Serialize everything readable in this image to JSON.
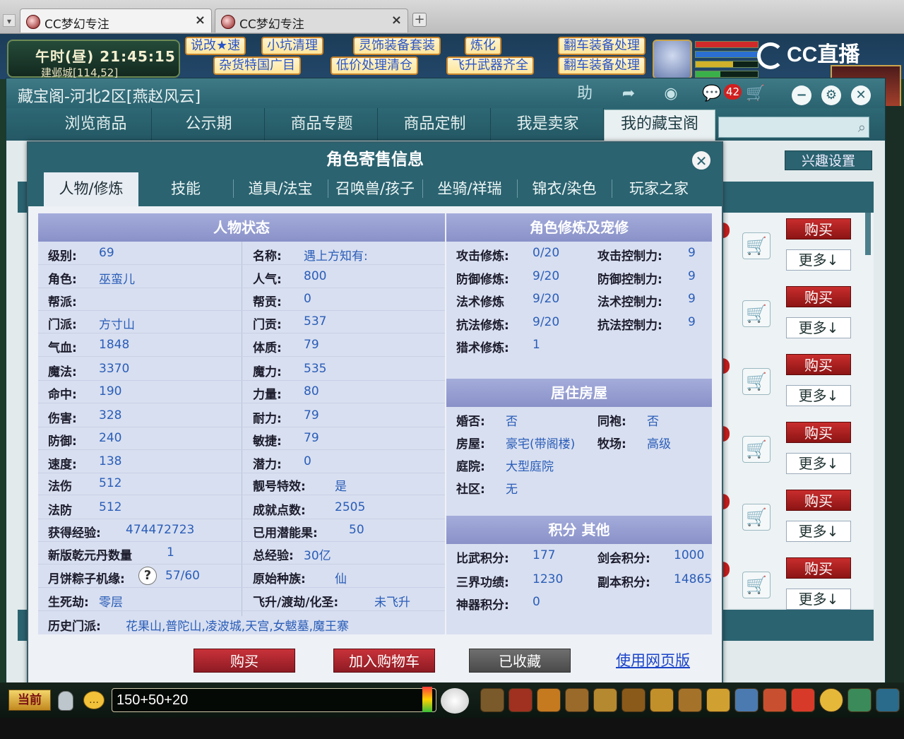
{
  "browser": {
    "tabs": [
      {
        "title": "CC梦幻专注",
        "close": "×"
      },
      {
        "title": "CC梦幻专注",
        "close": "×"
      }
    ],
    "new_tab": "+",
    "menu": "▾"
  },
  "game_hud": {
    "clock": "午时(昼)  21:45:15",
    "location": "建邺城[114,52]",
    "ads_row1": [
      "说改★速",
      "小坑清理",
      "灵饰装备套装",
      "炼化",
      "翻车装备处理"
    ],
    "ads_row2": [
      "杂货特国广目",
      "低价处理清仓",
      "飞升武器齐全",
      "翻车装备处理"
    ],
    "cc_logo": "CC直播"
  },
  "main_window": {
    "title": "藏宝阁-河北2区[燕赵风云]",
    "toolbar": {
      "help": "助",
      "share": "➦",
      "record": "◉",
      "chat": "💬",
      "chat_badge": "42",
      "cart": "🛒",
      "minimize": "−",
      "settings": "⚙",
      "close": "✕"
    },
    "nav": [
      "浏览商品",
      "公示期",
      "商品专题",
      "商品定制",
      "我是卖家",
      "我的藏宝阁"
    ],
    "nav_active_index": 5,
    "search_placeholder": "",
    "interest_button": "兴趣设置",
    "list_buttons": {
      "buy": "购买",
      "more": "更多↓"
    },
    "list_count": 6
  },
  "modal": {
    "title": "角色寄售信息",
    "close": "✕",
    "tabs": [
      "人物/修炼",
      "技能",
      "道具/法宝",
      "召唤兽/孩子",
      "坐骑/祥瑞",
      "锦衣/染色",
      "玩家之家"
    ],
    "active_tab": 0,
    "status_panel": {
      "header": "人物状态",
      "left": [
        {
          "key": "级别:",
          "val": "69"
        },
        {
          "key": "角色:",
          "val": "巫蛮儿"
        },
        {
          "key": "帮派:",
          "val": ""
        },
        {
          "key": "门派:",
          "val": "方寸山"
        },
        {
          "key": "气血:",
          "val": "1848"
        },
        {
          "key": "魔法:",
          "val": "3370"
        },
        {
          "key": "命中:",
          "val": "190"
        },
        {
          "key": "伤害:",
          "val": "328"
        },
        {
          "key": "防御:",
          "val": "240"
        },
        {
          "key": "速度:",
          "val": "138"
        },
        {
          "key": "法伤",
          "val": "512"
        },
        {
          "key": "法防",
          "val": "512"
        },
        {
          "key": "获得经验:",
          "val": "474472723"
        },
        {
          "key": "新版乾元丹数量",
          "val": "1"
        },
        {
          "key": "月饼粽子机缘:",
          "val": "57/60"
        },
        {
          "key": "生死劫:",
          "val": "零层"
        }
      ],
      "right": [
        {
          "key": "名称:",
          "val": "遇上方知有:"
        },
        {
          "key": "人气:",
          "val": "800"
        },
        {
          "key": "帮贡:",
          "val": "0"
        },
        {
          "key": "门贡:",
          "val": "537"
        },
        {
          "key": "体质:",
          "val": "79"
        },
        {
          "key": "魔力:",
          "val": "535"
        },
        {
          "key": "力量:",
          "val": "80"
        },
        {
          "key": "耐力:",
          "val": "79"
        },
        {
          "key": "敏捷:",
          "val": "79"
        },
        {
          "key": "潜力:",
          "val": "0"
        },
        {
          "key": "靓号特效:",
          "val": "是"
        },
        {
          "key": "成就点数:",
          "val": "2505"
        },
        {
          "key": "已用潜能果:",
          "val": "50"
        },
        {
          "key": "总经验:",
          "val": "30亿"
        },
        {
          "key": "原始种族:",
          "val": "仙"
        },
        {
          "key": "飞升/渡劫/化圣:",
          "val": "未飞升"
        }
      ],
      "history_key": "历史门派:",
      "history_val": "花果山,普陀山,凌波城,天宫,女魃墓,魔王寨",
      "help_glyph": "?"
    },
    "cultivation_panel": {
      "header": "角色修炼及宠修",
      "rows": [
        {
          "k1": "攻击修炼:",
          "v1": "0/20",
          "k2": "攻击控制力:",
          "v2": "9"
        },
        {
          "k1": "防御修炼:",
          "v1": "9/20",
          "k2": "防御控制力:",
          "v2": "9"
        },
        {
          "k1": "法术修炼",
          "v1": "9/20",
          "k2": "法术控制力:",
          "v2": "9"
        },
        {
          "k1": "抗法修炼:",
          "v1": "9/20",
          "k2": "抗法控制力:",
          "v2": "9"
        },
        {
          "k1": "猎术修炼:",
          "v1": "1",
          "k2": "",
          "v2": ""
        }
      ]
    },
    "house_panel": {
      "header": "居住房屋",
      "rows": [
        {
          "k1": "婚否:",
          "v1": "否",
          "k2": "同袍:",
          "v2": "否"
        },
        {
          "k1": "房屋:",
          "v1": "豪宅(带阁楼)",
          "k2": "牧场:",
          "v2": "高级"
        },
        {
          "k1": "庭院:",
          "v1": "大型庭院",
          "k2": "",
          "v2": ""
        },
        {
          "k1": "社区:",
          "v1": "无",
          "k2": "",
          "v2": ""
        }
      ]
    },
    "score_panel": {
      "header": "积分 其他",
      "rows": [
        {
          "k1": "比武积分:",
          "v1": "177",
          "k2": "剑会积分:",
          "v2": "1000"
        },
        {
          "k1": "三界功绩:",
          "v1": "1230",
          "k2": "副本积分:",
          "v2": "14865"
        },
        {
          "k1": "神器积分:",
          "v1": "0",
          "k2": "",
          "v2": ""
        }
      ]
    },
    "actions": {
      "buy": "购买",
      "add_cart": "加入购物车",
      "favorited": "已收藏",
      "web_version": "使用网页版"
    }
  },
  "chat": {
    "channel": "当前",
    "input_value": "150+50+20",
    "speech_glyph": "…"
  },
  "colors": {
    "teal": "#2b6370",
    "panel_header": "#8991c8",
    "value_blue": "#2a5db8",
    "buy_red": "#b52626"
  }
}
